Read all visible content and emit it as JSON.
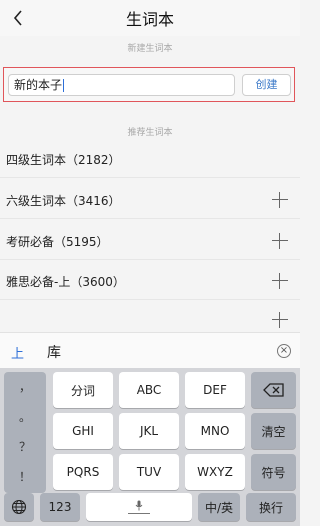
{
  "header": {
    "title": "生词本",
    "back_icon": "chevron-left-icon"
  },
  "new_section": {
    "label": "新建生词本",
    "input_value": "新的本子",
    "create_label": "创建"
  },
  "recommended": {
    "label": "推荐生词本",
    "items": [
      {
        "label": "四级生词本（2182）",
        "has_add": false
      },
      {
        "label": "六级生词本（3416）",
        "has_add": true
      },
      {
        "label": "考研必备（5195）",
        "has_add": true
      },
      {
        "label": "雅思必备-上（3600）",
        "has_add": true
      }
    ]
  },
  "ime": {
    "candidate_left": "上",
    "candidate_right": "库",
    "clear_icon": "clear-circle-icon",
    "punctuation": [
      "，",
      "。",
      "？",
      "！"
    ],
    "keys_row1": [
      "分词",
      "ABC",
      "DEF"
    ],
    "keys_row2": [
      "GHI",
      "JKL",
      "MNO"
    ],
    "keys_row3": [
      "PQRS",
      "TUV",
      "WXYZ"
    ],
    "backspace_icon": "backspace-icon",
    "clear_label": "清空",
    "symbol_label": "符号",
    "globe_icon": "globe-icon",
    "num_label": "123",
    "space_icon": "microphone-icon",
    "lang_label": "中/英",
    "return_label": "换行"
  }
}
